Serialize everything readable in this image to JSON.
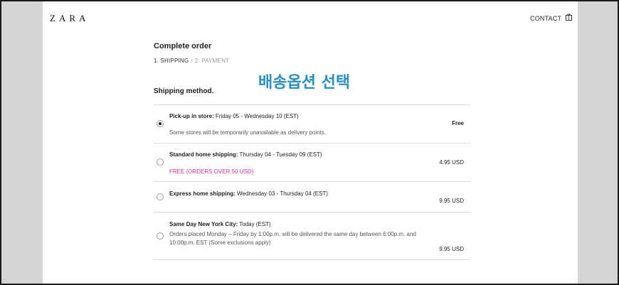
{
  "header": {
    "logo": "ZARA",
    "contact_label": "CONTACT",
    "bag_icon": "shopping-bag-icon"
  },
  "checkout": {
    "title": "Complete order",
    "step1": "1. SHIPPING",
    "step_separator": "/",
    "step2": "2. PAYMENT"
  },
  "overlay_text": "배송옵션 선택",
  "overlay_color": "#2a8fc0",
  "shipping": {
    "section_title": "Shipping method.",
    "options": [
      {
        "name": "Pick-up in store:",
        "dates": " Friday 05 - Wednesday 10 (EST)",
        "note": "Some stores will be temporarily unavailable as delivery points.",
        "price": "Free",
        "selected": true
      },
      {
        "name": "Standard home shipping:",
        "dates": " Thursday 04 - Tuesday 09 (EST)",
        "note": "FREE (ORDERS OVER 50 USD)",
        "note_color": "#e0309a",
        "price": "4.95 USD",
        "selected": false
      },
      {
        "name": "Express home shipping:",
        "dates": " Wednesday 03 - Thursday 04 (EST)",
        "price": "9.95 USD",
        "selected": false
      },
      {
        "name": "Same Day New York City:",
        "dates": " Today (EST)",
        "note": "Orders placed Monday – Friday by 1:00p.m. will be delivered the same day between 6:00p.m. and 10:00p.m. EST (Some exclusions apply)",
        "price": "9.95 USD",
        "selected": false
      }
    ]
  }
}
